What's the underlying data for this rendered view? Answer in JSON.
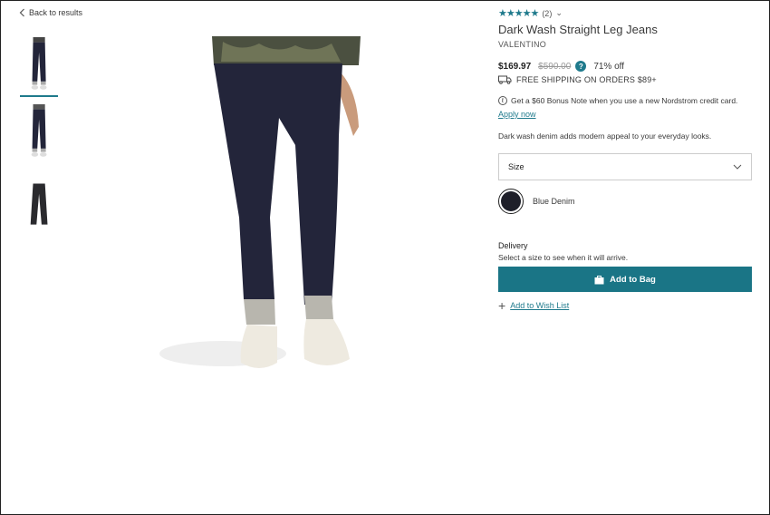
{
  "nav": {
    "back_label": "Back to results"
  },
  "product": {
    "review_count": "(2)",
    "title": "Dark Wash Straight Leg Jeans",
    "brand": "VALENTINO",
    "price": "$169.97",
    "original_price": "$590.00",
    "discount": "71% off",
    "shipping": "FREE SHIPPING ON ORDERS $89+",
    "bonus_text": "Get a $60 Bonus Note when you use a new Nordstrom credit card.",
    "apply_label": "Apply now",
    "description": "Dark wash denim adds modern appeal to your everyday looks.",
    "size_label": "Size",
    "color_name": "Blue Denim",
    "delivery_heading": "Delivery",
    "delivery_text": "Select a size to see when it will arrive.",
    "add_to_bag_label": "Add to Bag",
    "wishlist_label": "Add to Wish List",
    "rating": 5,
    "rating_max": 5
  },
  "colors": {
    "accent": "#1f7a8c",
    "button": "#1a7586",
    "denim": "#1e1f29"
  },
  "icons": [
    "chevron-left-icon",
    "star-icon",
    "chevron-down-icon",
    "question-icon",
    "truck-icon",
    "credit-card-icon",
    "bag-icon",
    "plus-icon"
  ]
}
